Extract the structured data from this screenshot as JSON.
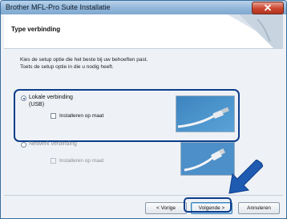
{
  "window": {
    "title": "Brother MFL-Pro Suite Installatie",
    "close_icon": "close-icon"
  },
  "header": {
    "title": "Type verbinding"
  },
  "instructions": {
    "line1": "Kies de setup optie die het beste bij uw behoeften past.",
    "line2": "Toets de setup optie in die u nodig heeft."
  },
  "options": {
    "local": {
      "label": "Lokale verbinding",
      "sublabel": "(USB)",
      "selected": true,
      "custom_install_label": "Installeren op maat",
      "custom_install_checked": false,
      "image_icon": "usb-cable-photo"
    },
    "network": {
      "label": "Netwerk verbinding",
      "selected": false,
      "custom_install_label": "Installeren op maat",
      "custom_install_checked": false,
      "custom_install_enabled": false,
      "image_icon": "network-cable-photo"
    }
  },
  "buttons": {
    "back": "< Vorige",
    "next": "Volgende >",
    "cancel": "Annuleren"
  },
  "colors": {
    "highlight": "#0d3d8c",
    "arrow": "#1f5bb0",
    "close_button": "#c9452f"
  }
}
